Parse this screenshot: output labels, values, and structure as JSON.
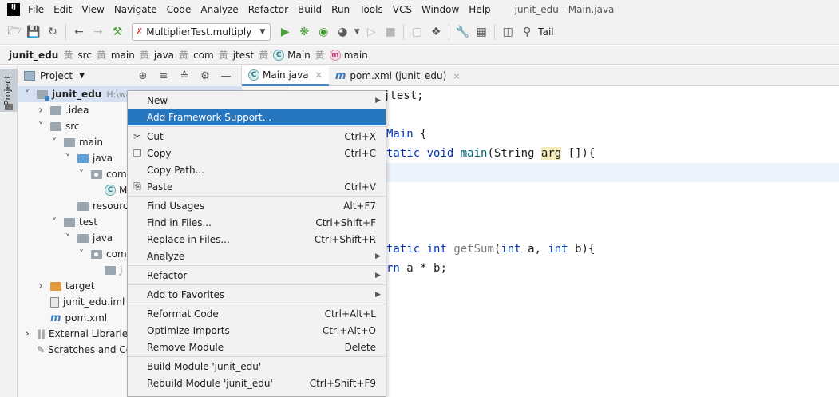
{
  "menu": {
    "items": [
      "File",
      "Edit",
      "View",
      "Navigate",
      "Code",
      "Analyze",
      "Refactor",
      "Build",
      "Run",
      "Tools",
      "VCS",
      "Window",
      "Help"
    ],
    "window_title": "junit_edu - Main.java"
  },
  "toolbar": {
    "run_config": "MultiplierTest.multiply",
    "tail_label": "Tail"
  },
  "breadcrumb": [
    "junit_edu",
    "src",
    "main",
    "java",
    "com",
    "jtest",
    "Main",
    "main"
  ],
  "tool_window": {
    "label": "Project"
  },
  "project": {
    "title": "Project",
    "tree": [
      {
        "label": "junit_edu",
        "hint": "H:\\wo",
        "level": 0,
        "arrow": "down",
        "icon": "module",
        "selected": true
      },
      {
        "label": ".idea",
        "level": 1,
        "arrow": "right",
        "icon": "folder"
      },
      {
        "label": "src",
        "level": 1,
        "arrow": "down",
        "icon": "folder"
      },
      {
        "label": "main",
        "level": 2,
        "arrow": "down",
        "icon": "folder"
      },
      {
        "label": "java",
        "level": 3,
        "arrow": "down",
        "icon": "blue-folder"
      },
      {
        "label": "com",
        "level": 4,
        "arrow": "down",
        "icon": "package"
      },
      {
        "label": "M",
        "level": 5,
        "arrow": "",
        "icon": "class"
      },
      {
        "label": "resourc",
        "level": 3,
        "arrow": "",
        "icon": "folder"
      },
      {
        "label": "test",
        "level": 2,
        "arrow": "down",
        "icon": "folder"
      },
      {
        "label": "java",
        "level": 3,
        "arrow": "down",
        "icon": "folder"
      },
      {
        "label": "com",
        "level": 4,
        "arrow": "down",
        "icon": "package"
      },
      {
        "label": "j",
        "level": 5,
        "arrow": "",
        "icon": "folder"
      },
      {
        "label": "target",
        "level": 1,
        "arrow": "right",
        "icon": "orange-folder"
      },
      {
        "label": "junit_edu.iml",
        "level": 1,
        "arrow": "",
        "icon": "file"
      },
      {
        "label": "pom.xml",
        "level": 1,
        "arrow": "",
        "icon": "maven"
      },
      {
        "label": "External Libraries",
        "level": 0,
        "arrow": "right",
        "icon": "library"
      },
      {
        "label": "Scratches and Co",
        "level": 0,
        "arrow": "",
        "icon": "scratch"
      }
    ]
  },
  "editor": {
    "tabs": [
      {
        "label": "Main.java",
        "icon": "C",
        "active": true
      },
      {
        "label": "pom.xml (junit_edu)",
        "icon": "m",
        "active": false
      }
    ],
    "close_glyph": "×",
    "lines": {
      "l1": "jtest;",
      "l3_kw": "Main",
      "l3_brace": "{",
      "l4_kw1": "tatic",
      "l4_kw2": "void",
      "l4_fn": "main",
      "l4_type": "String",
      "l4_arg": "arg",
      "l4_rest": "[]){",
      "l8_kw1": "tatic",
      "l8_kw2": "int",
      "l8_fn": "getSum",
      "l8_kw3": "int",
      "l8_a": "a,",
      "l8_kw4": "int",
      "l8_b": "b){",
      "l9_kw": "rn",
      "l9_rest": "a * b;"
    }
  },
  "context_menu": {
    "items": [
      {
        "label": "New",
        "shortcut": "",
        "submenu": true,
        "icon": ""
      },
      {
        "label": "Add Framework Support...",
        "shortcut": "",
        "submenu": false,
        "icon": "",
        "active": true
      },
      {
        "label": "Cut",
        "shortcut": "Ctrl+X",
        "submenu": false,
        "icon": "scissors"
      },
      {
        "label": "Copy",
        "shortcut": "Ctrl+C",
        "submenu": false,
        "icon": "copy"
      },
      {
        "label": "Copy Path...",
        "shortcut": "",
        "submenu": false,
        "icon": ""
      },
      {
        "label": "Paste",
        "shortcut": "Ctrl+V",
        "submenu": false,
        "icon": "clipboard"
      },
      {
        "label": "Find Usages",
        "shortcut": "Alt+F7",
        "submenu": false,
        "icon": ""
      },
      {
        "label": "Find in Files...",
        "shortcut": "Ctrl+Shift+F",
        "submenu": false,
        "icon": ""
      },
      {
        "label": "Replace in Files...",
        "shortcut": "Ctrl+Shift+R",
        "submenu": false,
        "icon": ""
      },
      {
        "label": "Analyze",
        "shortcut": "",
        "submenu": true,
        "icon": ""
      },
      {
        "label": "Refactor",
        "shortcut": "",
        "submenu": true,
        "icon": ""
      },
      {
        "label": "Add to Favorites",
        "shortcut": "",
        "submenu": true,
        "icon": ""
      },
      {
        "label": "Reformat Code",
        "shortcut": "Ctrl+Alt+L",
        "submenu": false,
        "icon": ""
      },
      {
        "label": "Optimize Imports",
        "shortcut": "Ctrl+Alt+O",
        "submenu": false,
        "icon": ""
      },
      {
        "label": "Remove Module",
        "shortcut": "Delete",
        "submenu": false,
        "icon": ""
      },
      {
        "label": "Build Module 'junit_edu'",
        "shortcut": "",
        "submenu": false,
        "icon": ""
      },
      {
        "label": "Rebuild Module 'junit_edu'",
        "shortcut": "Ctrl+Shift+F9",
        "submenu": false,
        "icon": ""
      }
    ]
  },
  "colors": {
    "selection": "#2675bf",
    "accent": "#4083c9",
    "keyword": "#0033b3"
  }
}
